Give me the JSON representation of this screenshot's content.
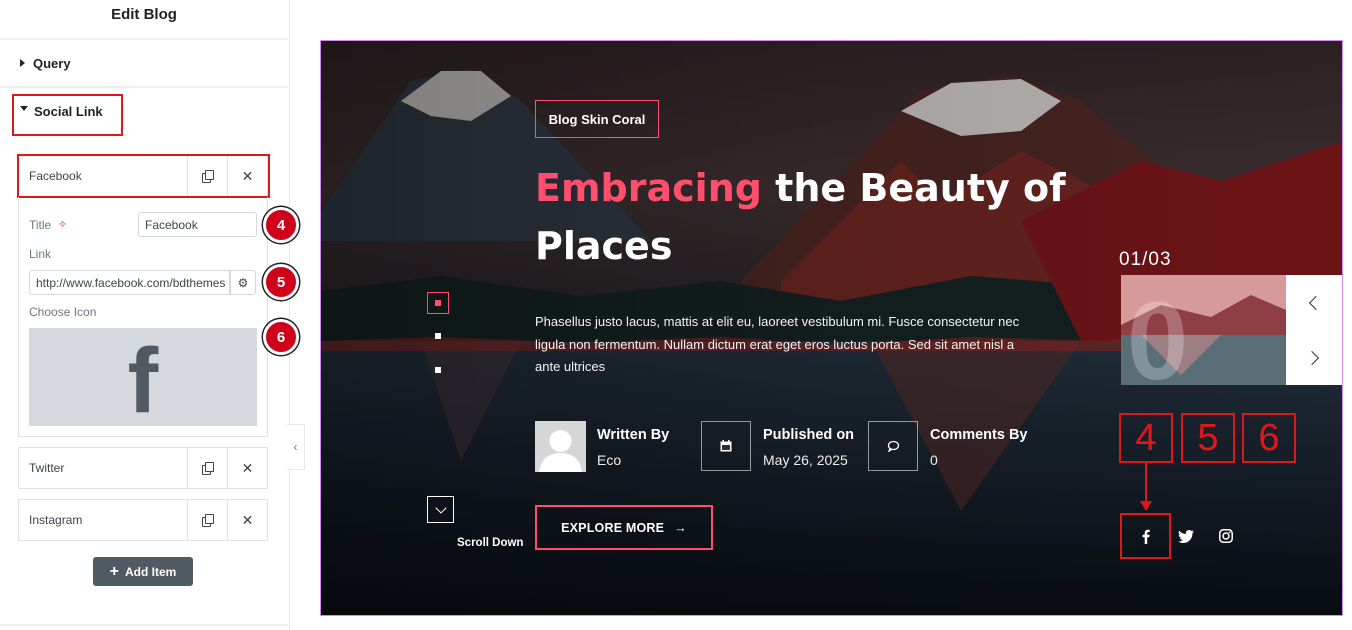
{
  "panel": {
    "title": "Edit Blog",
    "sections": {
      "query": "Query",
      "social_link": "Social Link"
    },
    "repeater": {
      "items": [
        "Facebook",
        "Twitter",
        "Instagram"
      ],
      "fields": {
        "title_label": "Title",
        "title_value": "Facebook",
        "link_label": "Link",
        "link_value": "http://www.facebook.com/bdthemes",
        "icon_label": "Choose Icon",
        "icon_glyph": "f"
      },
      "add_label": "Add Item"
    },
    "badges": [
      "4",
      "5",
      "6"
    ]
  },
  "preview": {
    "category": "Blog Skin Coral",
    "headline_accent": "Embracing",
    "headline_rest": " the Beauty of Places",
    "description": "Phasellus justo lacus, mattis at elit eu, laoreet vestibulum mi. Fusce consectetur nec ligula non fermentum. Nullam dictum erat eget eros luctus porta. Sed sit amet nisl a ante ultrices",
    "meta": {
      "author_title": "Written By",
      "author_value": "Eco",
      "published_title": "Published on",
      "published_value": "May 26, 2025",
      "comments_title": "Comments By",
      "comments_value": "0"
    },
    "scroll_down": "Scroll Down",
    "explore_label": "EXPLORE MORE",
    "counter_current": "01",
    "counter_sep": "/",
    "counter_total": "03",
    "annot_numbers": [
      "4",
      "5",
      "6"
    ]
  },
  "colors": {
    "accent": "#ff4f6d",
    "annotation_red": "#e0161b",
    "preview_border": "#d38cf0",
    "button_dark": "#515962"
  },
  "icons": [
    "caret-right-icon",
    "caret-down-icon",
    "duplicate-icon",
    "close-icon",
    "ai-sparkle-icon",
    "gear-icon",
    "facebook-icon",
    "twitter-icon",
    "instagram-icon",
    "calendar-icon",
    "comment-icon",
    "chevron-down-icon",
    "arrow-right-icon",
    "chevron-left-icon",
    "chevron-right-icon",
    "plus-icon"
  ]
}
